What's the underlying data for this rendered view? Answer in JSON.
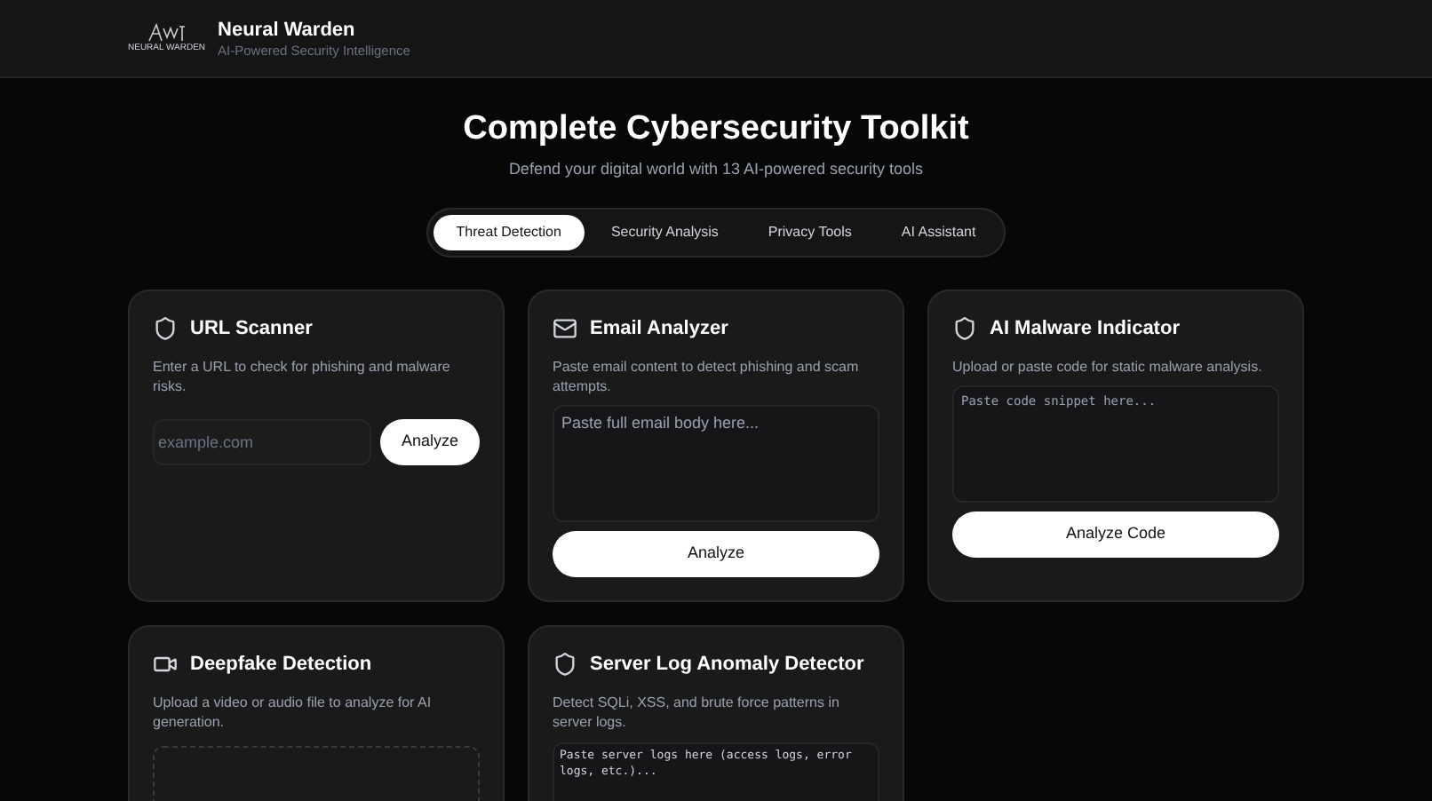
{
  "header": {
    "logo_text": "NEURAL WARDEN",
    "title": "Neural Warden",
    "subtitle": "AI-Powered Security Intelligence"
  },
  "hero": {
    "title": "Complete Cybersecurity Toolkit",
    "subtitle": "Defend your digital world with 13 AI-powered security tools"
  },
  "tabs": [
    {
      "label": "Threat Detection",
      "selected": true
    },
    {
      "label": "Security Analysis",
      "selected": false
    },
    {
      "label": "Privacy Tools",
      "selected": false
    },
    {
      "label": "AI Assistant",
      "selected": false
    }
  ],
  "cards": [
    {
      "kind": "url",
      "title": "URL Scanner",
      "description": "Enter a URL to check for phishing and malware risks.",
      "placeholder": "example.com",
      "button": "Analyze"
    },
    {
      "kind": "email",
      "title": "Email Analyzer",
      "description": "Paste email content to detect phishing and scam attempts.",
      "placeholder": "Paste full email body here...",
      "button": "Analyze"
    },
    {
      "kind": "code",
      "title": "AI Malware Indicator",
      "description": "Upload or paste code for static malware analysis.",
      "placeholder": "Paste code snippet here...",
      "button": "Analyze Code"
    },
    {
      "kind": "media",
      "title": "Deepfake Detection",
      "description": "Upload a video or audio file to analyze for AI generation."
    },
    {
      "kind": "logs",
      "title": "Server Log Anomaly Detector",
      "description": "Detect SQLi, XSS, and brute force patterns in server logs.",
      "placeholder": "Paste server logs here (access logs, error logs, etc.)..."
    }
  ]
}
